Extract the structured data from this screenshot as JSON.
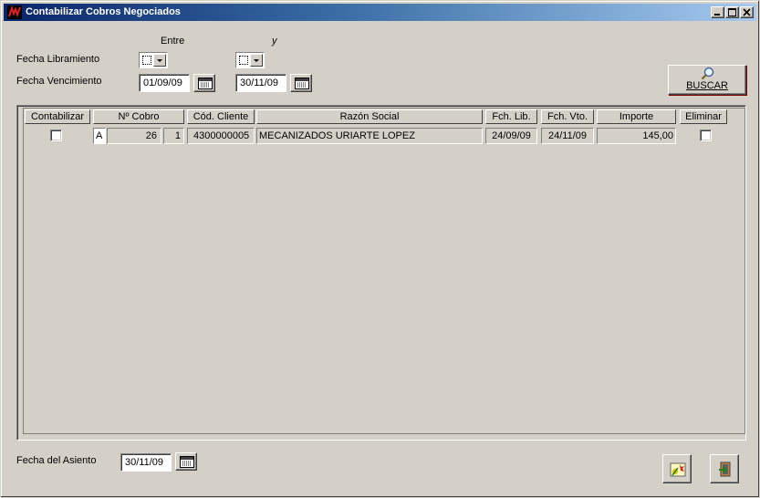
{
  "window": {
    "title": "Contabilizar Cobros Negociados",
    "controls": [
      "minimize-icon",
      "maximize-icon",
      "close-icon"
    ]
  },
  "filters": {
    "entre_label": "Entre",
    "y_label": "y",
    "fecha_libramiento_label": "Fecha Libramiento",
    "fecha_vencimiento_label": "Fecha Vencimiento",
    "vencimiento_desde": "01/09/09",
    "vencimiento_hasta": "30/11/09"
  },
  "buscar": {
    "label": "BUSCAR",
    "icon": "magnifier-icon"
  },
  "grid": {
    "headers": [
      "Contabilizar",
      "Nº Cobro",
      "Cód. Cliente",
      "Razón Social",
      "Fch. Lib.",
      "Fch. Vto.",
      "Importe",
      "Eliminar"
    ],
    "rows": [
      {
        "contabilizar": false,
        "serie": "A",
        "numero": "26",
        "linea": "1",
        "cod_cliente": "4300000005",
        "razon_social": "MECANIZADOS URIARTE LOPEZ",
        "fch_lib": "24/09/09",
        "fch_vto": "24/11/09",
        "importe": "145,00",
        "eliminar": false
      }
    ]
  },
  "footer": {
    "fecha_asiento_label": "Fecha del Asiento",
    "fecha_asiento": "30/11/09",
    "contabilizar_icon": "post-entries-icon",
    "salir_icon": "exit-door-icon"
  },
  "colors": {
    "face": "#d4d0c8",
    "title_start": "#0a246a",
    "title_end": "#a6caf0"
  }
}
